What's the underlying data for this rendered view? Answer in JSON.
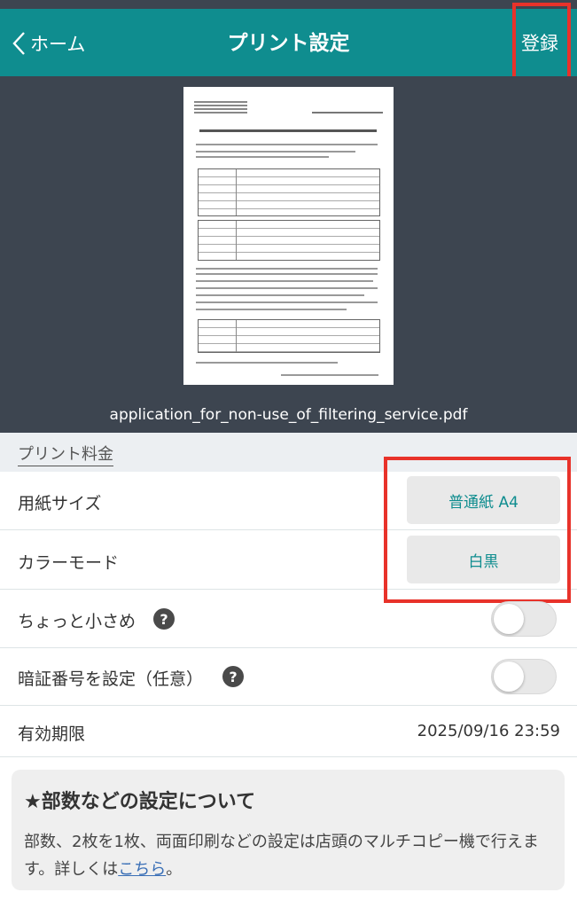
{
  "header": {
    "back_label": "ホーム",
    "title": "プリント設定",
    "register_label": "登録"
  },
  "preview": {
    "filename": "application_for_non-use_of_filtering_service.pdf"
  },
  "section": {
    "title": "プリント料金"
  },
  "settings": {
    "paper_size": {
      "label": "用紙サイズ",
      "value": "普通紙 A4"
    },
    "color_mode": {
      "label": "カラーモード",
      "value": "白黒"
    },
    "smaller": {
      "label": "ちょっと小さめ",
      "help": "?",
      "enabled": false
    },
    "pin": {
      "label": "暗証番号を設定（任意）",
      "help": "?",
      "enabled": false
    },
    "expiry": {
      "label": "有効期限",
      "value": "2025/09/16 23:59"
    }
  },
  "info": {
    "title": "★部数などの設定について",
    "body": "部数、2枚を1枚、両面印刷などの設定は店頭のマルチコピー機で行えます。詳しくは",
    "link": "こちら",
    "suffix": "。"
  },
  "colors": {
    "header_bg": "#0f8d8f",
    "accent": "#0f8d8f",
    "highlight": "#e8322a"
  }
}
